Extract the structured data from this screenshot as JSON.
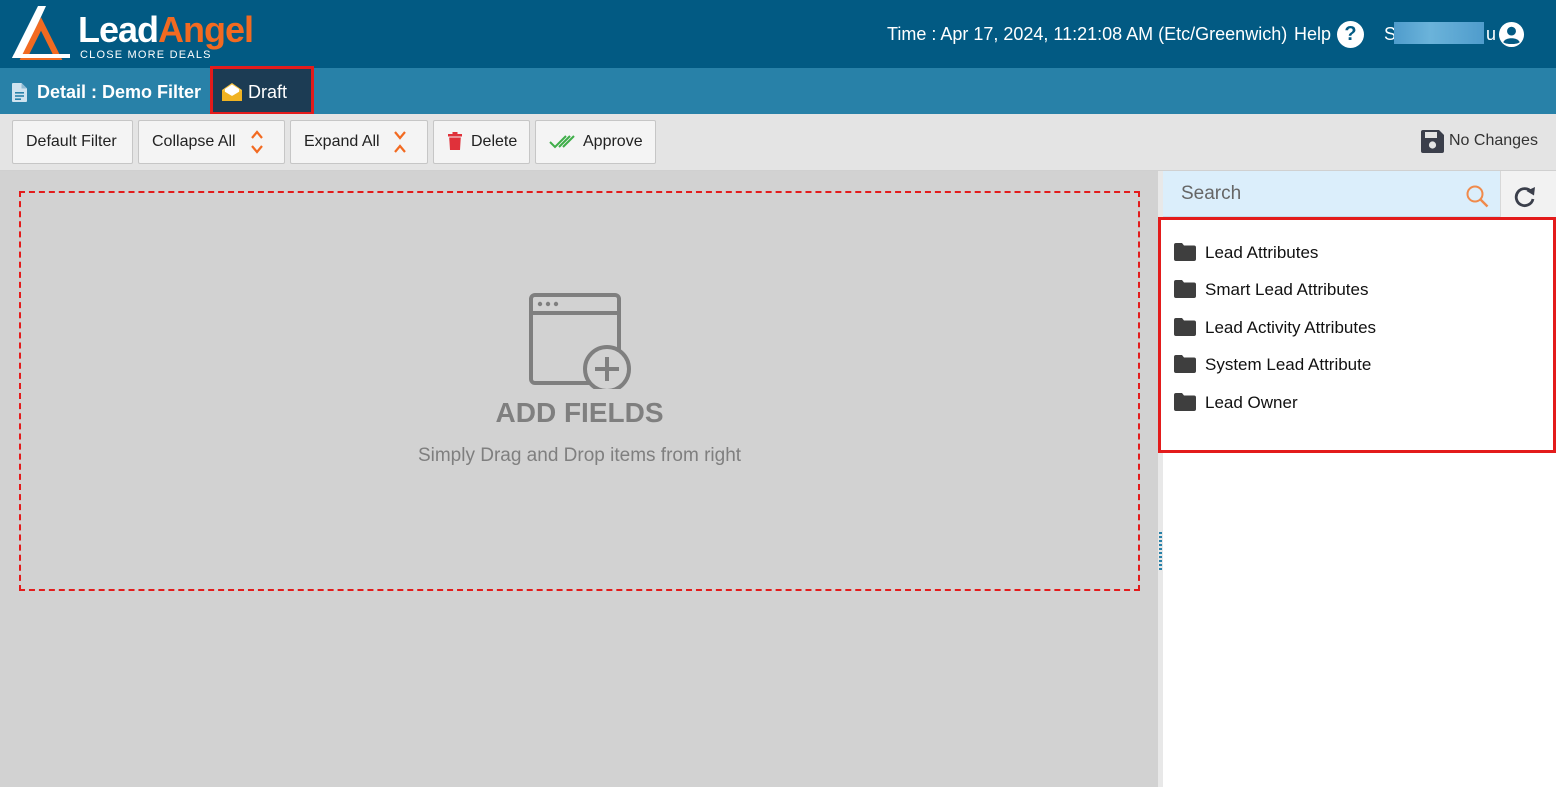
{
  "header": {
    "brand_primary": "Lead",
    "brand_secondary": "Angel",
    "tagline": "CLOSE MORE DEALS",
    "time": "Time : Apr 17, 2024, 11:21:08 AM (Etc/Greenwich)",
    "help_label": "Help",
    "help_icon_glyph": "?",
    "user_initial": "S",
    "user_tail": "u",
    "colors": {
      "bar": "#025a83",
      "accent": "#f26a21"
    }
  },
  "subheader": {
    "title": "Detail : Demo Filter",
    "status_tab": "Draft",
    "colors": {
      "bar": "#2881a8",
      "status_tab_bg": "#1c3c54",
      "highlight": "#e31b1b"
    }
  },
  "toolbar": {
    "buttons": [
      {
        "label": "Default Filter",
        "icon": ""
      },
      {
        "label": "Collapse All",
        "icon": "collapse-chevrons-icon"
      },
      {
        "label": "Expand All",
        "icon": "expand-chevrons-icon"
      },
      {
        "label": "Delete",
        "icon": "trash-icon"
      },
      {
        "label": "Approve",
        "icon": "double-check-icon"
      }
    ],
    "save_status": "No Changes"
  },
  "dropzone": {
    "title": "ADD FIELDS",
    "subtitle": "Simply Drag and Drop items from right"
  },
  "sidebar": {
    "search_placeholder": "Search",
    "items": [
      {
        "label": "Lead Attributes",
        "icon": "folder-icon"
      },
      {
        "label": "Smart Lead Attributes",
        "icon": "folder-icon"
      },
      {
        "label": "Lead Activity Attributes",
        "icon": "folder-icon"
      },
      {
        "label": "System Lead Attribute",
        "icon": "folder-icon"
      },
      {
        "label": "Lead Owner",
        "icon": "folder-icon"
      }
    ]
  }
}
